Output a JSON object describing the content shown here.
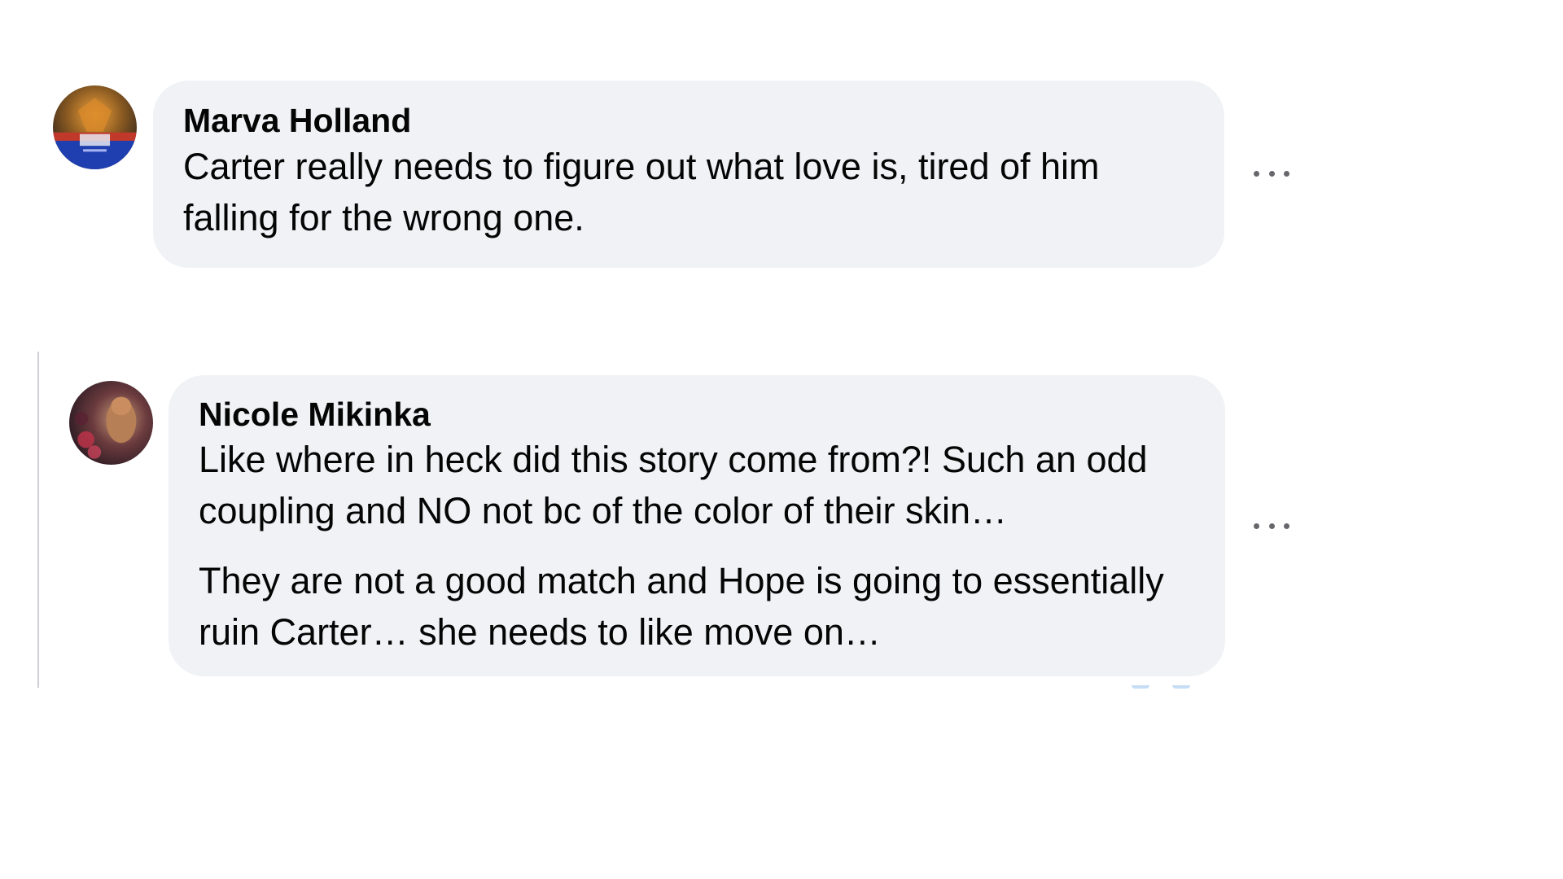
{
  "comments": [
    {
      "author": "Marva Holland",
      "paragraphs": [
        "Carter really needs to figure out what love is, tired of him falling for the wrong one."
      ],
      "more_icon": "more-horizontal-icon"
    },
    {
      "author": "Nicole Mikinka",
      "paragraphs": [
        "Like where in heck did this story come from?! Such an odd coupling and NO not bc of the color of their skin…",
        "They are not a good match and Hope is going to essentially ruin Carter… she needs to like move on…"
      ],
      "more_icon": "more-horizontal-icon"
    }
  ],
  "colors": {
    "bubble_background": "#f0f2f5",
    "text": "#050505",
    "icon": "#65676b",
    "thread_line": "#ced0d4"
  }
}
